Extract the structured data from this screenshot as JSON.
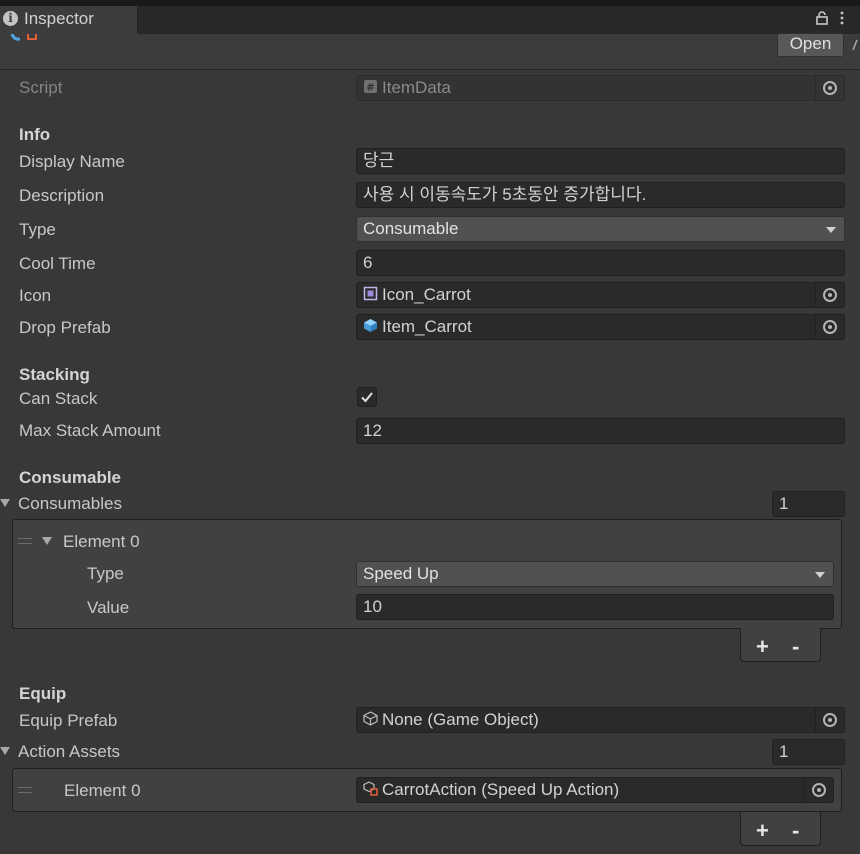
{
  "window": {
    "tab_title": "Inspector",
    "open_label": "Open"
  },
  "script_row": {
    "label": "Script",
    "value": "ItemData"
  },
  "info": {
    "header": "Info",
    "display_name": {
      "label": "Display Name",
      "value": "당근"
    },
    "description": {
      "label": "Description",
      "value": "사용 시 이동속도가 5초동안 증가합니다."
    },
    "type": {
      "label": "Type",
      "value": "Consumable"
    },
    "cool_time": {
      "label": "Cool Time",
      "value": "6"
    },
    "icon": {
      "label": "Icon",
      "value": "Icon_Carrot"
    },
    "drop_prefab": {
      "label": "Drop Prefab",
      "value": "Item_Carrot"
    }
  },
  "stacking": {
    "header": "Stacking",
    "can_stack": {
      "label": "Can Stack",
      "checked": true
    },
    "max_stack": {
      "label": "Max Stack Amount",
      "value": "12"
    }
  },
  "consumable": {
    "header": "Consumable",
    "list": {
      "label": "Consumables",
      "count": "1"
    },
    "element": {
      "label": "Element 0",
      "type_label": "Type",
      "type_value": "Speed Up",
      "value_label": "Value",
      "value": "10"
    },
    "add": "+",
    "remove": "-"
  },
  "equip": {
    "header": "Equip",
    "prefab": {
      "label": "Equip Prefab",
      "value": "None (Game Object)"
    },
    "assets": {
      "label": "Action Assets",
      "count": "1"
    },
    "element": {
      "label": "Element 0",
      "value": "CarrotAction (Speed Up Action)"
    },
    "add": "+",
    "remove": "-"
  },
  "icons": {
    "tab": "info-icon",
    "lock": "lock-icon",
    "menu": "kebab-menu-icon",
    "script": "csharp-script-icon",
    "sprite": "sprite-icon",
    "prefab": "prefab-cube-icon",
    "gameobject": "gameobject-icon",
    "scriptable": "scriptable-object-icon",
    "picker": "object-picker-icon"
  },
  "colors": {
    "background": "#383838",
    "field": "#2a2a2a",
    "accent_prefab": "#5fb5f0",
    "text": "#c8c8c8"
  }
}
